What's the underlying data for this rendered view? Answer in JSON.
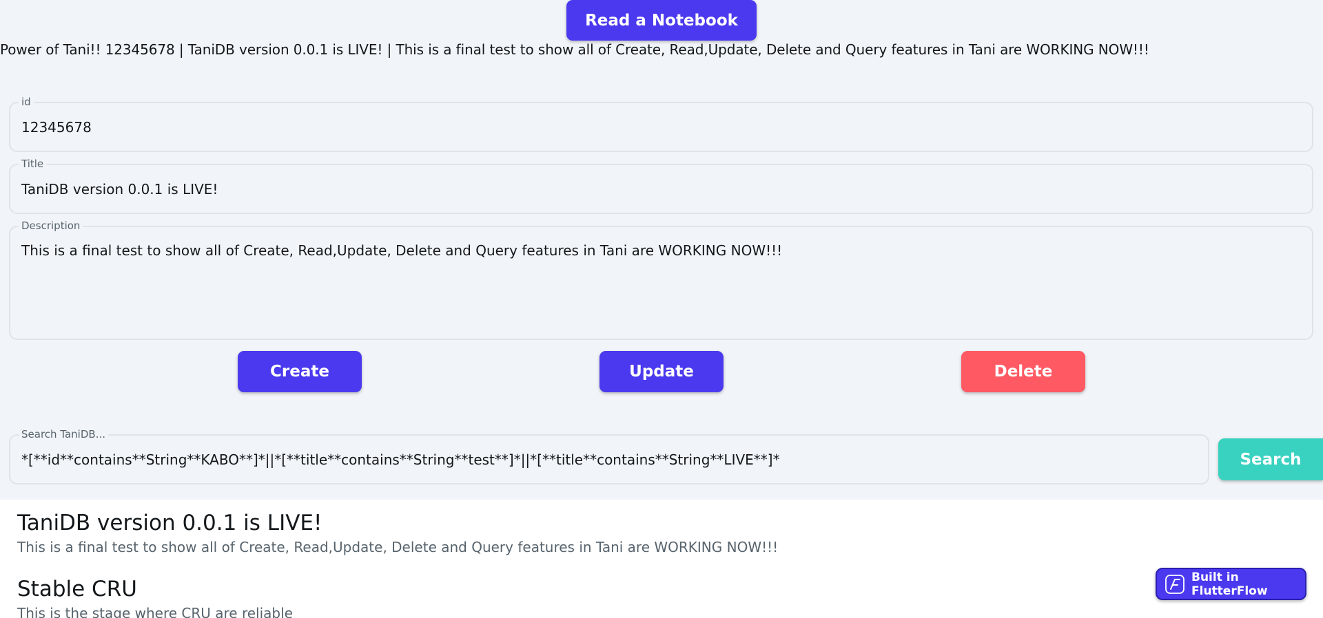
{
  "header": {
    "read_button": "Read a Notebook",
    "summary": "Power of Tani!! 12345678 | TaniDB version 0.0.1 is LIVE! | This is a final test to show all of Create, Read,Update, Delete and Query features in Tani are WORKING NOW!!!"
  },
  "form": {
    "id": {
      "label": "id",
      "value": "12345678"
    },
    "title": {
      "label": "Title",
      "value": "TaniDB version 0.0.1 is LIVE!"
    },
    "description": {
      "label": "Description",
      "value": "This is a final test to show all of Create, Read,Update, Delete and Query features in Tani are WORKING NOW!!!"
    }
  },
  "actions": {
    "create": "Create",
    "update": "Update",
    "delete": "Delete"
  },
  "search": {
    "label": "Search TaniDB...",
    "value": "*[**id**contains**String**KABO**]*||*[**title**contains**String**test**]*||*[**title**contains**String**LIVE**]*",
    "button": "Search"
  },
  "results": [
    {
      "title": "TaniDB version 0.0.1 is LIVE!",
      "description": "This is a final test to show all of Create, Read,Update, Delete and Query features in Tani are WORKING NOW!!!"
    },
    {
      "title": "Stable CRU",
      "description": "This is the stage where CRU are reliable"
    }
  ],
  "badge": {
    "label": "Built in FlutterFlow",
    "icon": "flutterflow-logo-icon"
  },
  "colors": {
    "primary": "#4b39ef",
    "danger": "#ff5963",
    "tertiary": "#39d2c0",
    "background": "#f1f4f8"
  }
}
